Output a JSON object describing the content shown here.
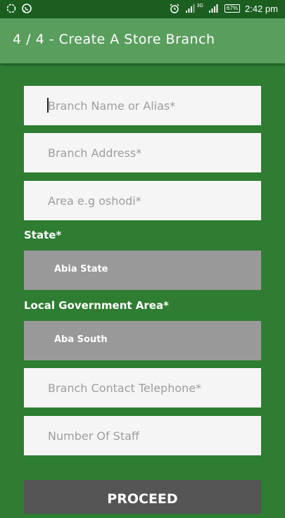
{
  "status_bar": {
    "battery": "67%",
    "time": "2:42 pm",
    "network": "3G",
    "icons": [
      "notification-ring-icon",
      "whatsapp-icon",
      "alarm-icon",
      "signal-icon",
      "signal-3g-icon",
      "battery-icon"
    ]
  },
  "appbar": {
    "title": "4 / 4 - Create A Store Branch"
  },
  "form": {
    "branch_name_placeholder": "Branch Name or Alias*",
    "branch_address_placeholder": "Branch Address*",
    "area_placeholder": "Area e.g oshodi*",
    "state_label": "State*",
    "state_value": "Abia State",
    "lga_label": "Local Government Area*",
    "lga_value": "Aba South",
    "telephone_placeholder": "Branch Contact Telephone*",
    "staff_placeholder": "Number Of Staff",
    "proceed_label": "PROCEED"
  },
  "colors": {
    "background": "#2e7d32",
    "appbar": "#5a9e5e",
    "field": "#f5f5f5",
    "select": "#999999",
    "button": "#555555"
  }
}
